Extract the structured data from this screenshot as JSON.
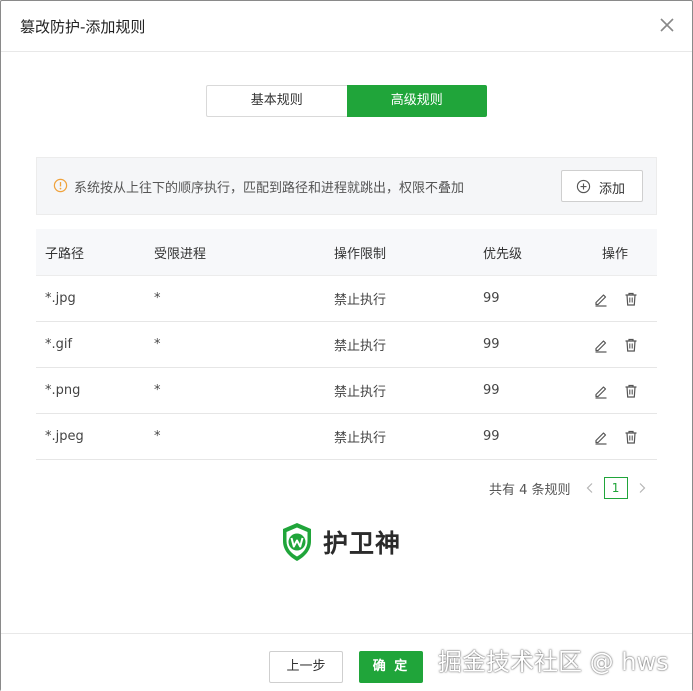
{
  "dialog": {
    "title": "篡改防护-添加规则"
  },
  "tabs": [
    {
      "label": "基本规则",
      "active": false
    },
    {
      "label": "高级规则",
      "active": true
    }
  ],
  "notice": {
    "text": "系统按从上往下的顺序执行，匹配到路径和进程就跳出，权限不叠加",
    "add_label": "添加"
  },
  "table": {
    "columns": [
      "子路径",
      "受限进程",
      "操作限制",
      "优先级",
      "操作"
    ],
    "rows": [
      {
        "path": "*.jpg",
        "process": "*",
        "restriction": "禁止执行",
        "priority": "99"
      },
      {
        "path": "*.gif",
        "process": "*",
        "restriction": "禁止执行",
        "priority": "99"
      },
      {
        "path": "*.png",
        "process": "*",
        "restriction": "禁止执行",
        "priority": "99"
      },
      {
        "path": "*.jpeg",
        "process": "*",
        "restriction": "禁止执行",
        "priority": "99"
      }
    ]
  },
  "pagination": {
    "total_text": "共有 4 条规则",
    "current_page": "1"
  },
  "brand": {
    "name": "护卫神"
  },
  "footer": {
    "prev_label": "上一步",
    "ok_label": "确 定"
  },
  "watermark": "掘金技术社区 @ hws",
  "colors": {
    "accent": "#20a53a",
    "warning": "#f0a23b"
  },
  "icons": [
    "close-icon",
    "warning-icon",
    "plus-circle-icon",
    "edit-icon",
    "delete-icon",
    "chevron-left-icon",
    "chevron-right-icon",
    "shield-logo-icon"
  ]
}
